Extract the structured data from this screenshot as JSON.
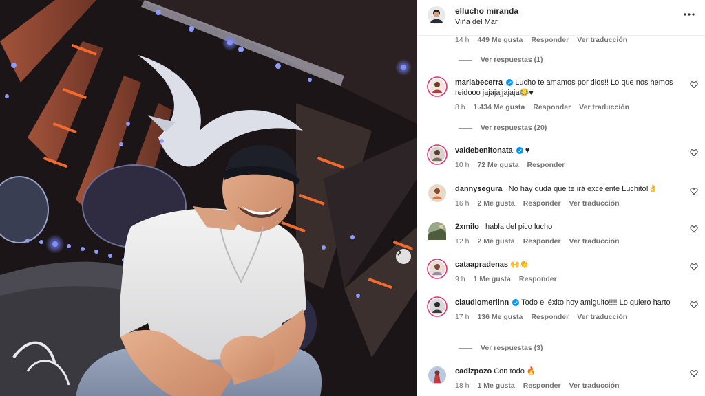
{
  "post": {
    "username": "ellucho miranda",
    "username_text": "ellucho miranda",
    "location": "Viña del Mar"
  },
  "top_meta": {
    "time": "14 h",
    "likes": "449 Me gusta",
    "reply": "Responder",
    "translate": "Ver traducción"
  },
  "top_replies": "Ver respuestas (1)",
  "comments": [
    {
      "user": "mariabecerra",
      "verified": true,
      "text": "Lucho te amamos por dios!! Lo que nos hemos reidooo jajajajjajaja😂♥",
      "time": "8 h",
      "likes": "1.434 Me gusta",
      "reply": "Responder",
      "translate": "Ver traducción",
      "replies": "Ver respuestas (20)"
    },
    {
      "user": "valdebenitonata",
      "verified": true,
      "text": "♥",
      "time": "10 h",
      "likes": "72 Me gusta",
      "reply": "Responder"
    },
    {
      "user": "dannysegura_",
      "verified": false,
      "text": "No hay duda que te irá excelente Luchito!👌",
      "time": "16 h",
      "likes": "2 Me gusta",
      "reply": "Responder",
      "translate": "Ver traducción"
    },
    {
      "user": "2xmilo_",
      "verified": false,
      "text": "habla del pico lucho",
      "time": "12 h",
      "likes": "2 Me gusta",
      "reply": "Responder",
      "translate": "Ver traducción"
    },
    {
      "user": "cataapradenas",
      "verified": false,
      "text": "🙌👏",
      "time": "9 h",
      "likes": "1 Me gusta",
      "reply": "Responder"
    },
    {
      "user": "claudiomerlinn",
      "verified": true,
      "text": "Todo el éxito hoy amiguito!!!! Lo quiero harto",
      "time": "17 h",
      "likes": "136 Me gusta",
      "reply": "Responder",
      "translate": "Ver traducción",
      "replies": "Ver respuestas (3)"
    },
    {
      "user": "cadizpozo",
      "verified": false,
      "text": "Con todo 🔥",
      "time": "18 h",
      "likes": "1 Me gusta",
      "reply": "Responder",
      "translate": "Ver traducción"
    }
  ],
  "colors": {
    "verified": "#0095f6",
    "muted": "#737373",
    "text": "#262626",
    "story_ring": "#d62976"
  }
}
